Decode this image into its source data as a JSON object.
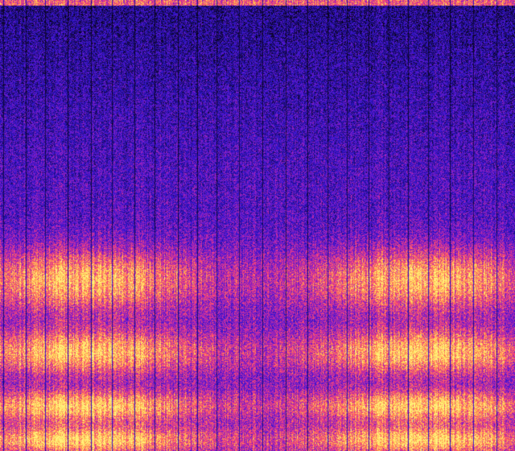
{
  "colors": {
    "background": "#1a0e6e",
    "colormap": [
      "#000000",
      "#1a0a5e",
      "#2a14c8",
      "#6a1ad0",
      "#c02aa8",
      "#ff4f6a",
      "#ffb24a",
      "#fff27a"
    ]
  },
  "spectrogram": {
    "bands": [
      {
        "level": 0.62,
        "width": 0.07
      },
      {
        "level": 0.78,
        "width": 0.05
      },
      {
        "level": 0.9,
        "width": 0.035
      },
      {
        "level": 0.975,
        "width": 0.03
      }
    ],
    "quiet_region": {
      "from": 0.0,
      "to": 0.38
    }
  }
}
